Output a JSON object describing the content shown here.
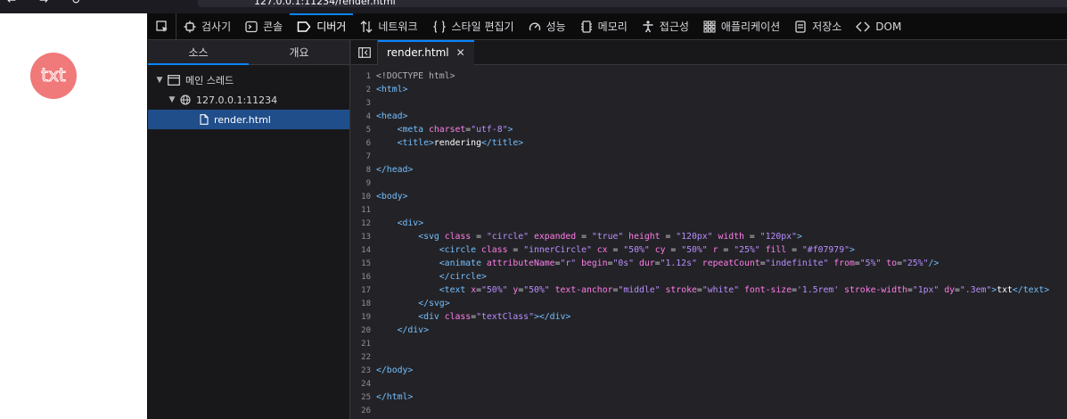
{
  "browser": {
    "url_partial": "127.0.0.1:11234/render.html"
  },
  "page": {
    "circle_label": "txt",
    "circle_fill": "#f07979"
  },
  "devtools": {
    "toolbar": {
      "tabs": [
        {
          "label": "검사기",
          "icon": "inspector-icon"
        },
        {
          "label": "콘솔",
          "icon": "console-icon"
        },
        {
          "label": "디버거",
          "icon": "debugger-icon",
          "active": true
        },
        {
          "label": "네트워크",
          "icon": "network-icon"
        },
        {
          "label": "스타일 편집기",
          "icon": "style-editor-icon"
        },
        {
          "label": "성능",
          "icon": "performance-icon"
        },
        {
          "label": "메모리",
          "icon": "memory-icon"
        },
        {
          "label": "접근성",
          "icon": "accessibility-icon"
        },
        {
          "label": "애플리케이션",
          "icon": "application-icon"
        },
        {
          "label": "저장소",
          "icon": "storage-icon"
        },
        {
          "label": "DOM",
          "icon": "dom-icon"
        }
      ]
    },
    "sources": {
      "tabs": [
        {
          "label": "소스",
          "active": true
        },
        {
          "label": "개요"
        }
      ],
      "tree": [
        {
          "label": "메인 스레드",
          "level": 0
        },
        {
          "label": "127.0.0.1:11234",
          "level": 1
        },
        {
          "label": "render.html",
          "level": 2,
          "selected": true
        }
      ]
    },
    "editor": {
      "tab_label": "render.html",
      "close_glyph": "✕",
      "lines": [
        "<!DOCTYPE html>",
        "<html>",
        "",
        "<head>",
        "    <meta charset=\"utf-8\">",
        "    <title>rendering</title>",
        "",
        "</head>",
        "",
        "<body>",
        "",
        "    <div>",
        "        <svg class = \"circle\" expanded = \"true\" height = \"120px\" width = \"120px\">",
        "            <circle class = \"innerCircle\" cx = \"50%\" cy = \"50%\" r = \"25%\" fill = \"#f07979\">",
        "            <animate attributeName=\"r\" begin=\"0s\" dur=\"1.12s\" repeatCount=\"indefinite\" from=\"5%\" to=\"25%\"/>",
        "            </circle>",
        "            <text x=\"50%\" y=\"50%\" text-anchor=\"middle\" stroke=\"white\" font-size='1.5rem' stroke-width=\"1px\" dy=\".3em\">txt</text>",
        "        </svg>",
        "        <div class=\"textClass\"></div>",
        "    </div>",
        "",
        "",
        "</body>",
        "",
        "</html>",
        ""
      ]
    }
  }
}
